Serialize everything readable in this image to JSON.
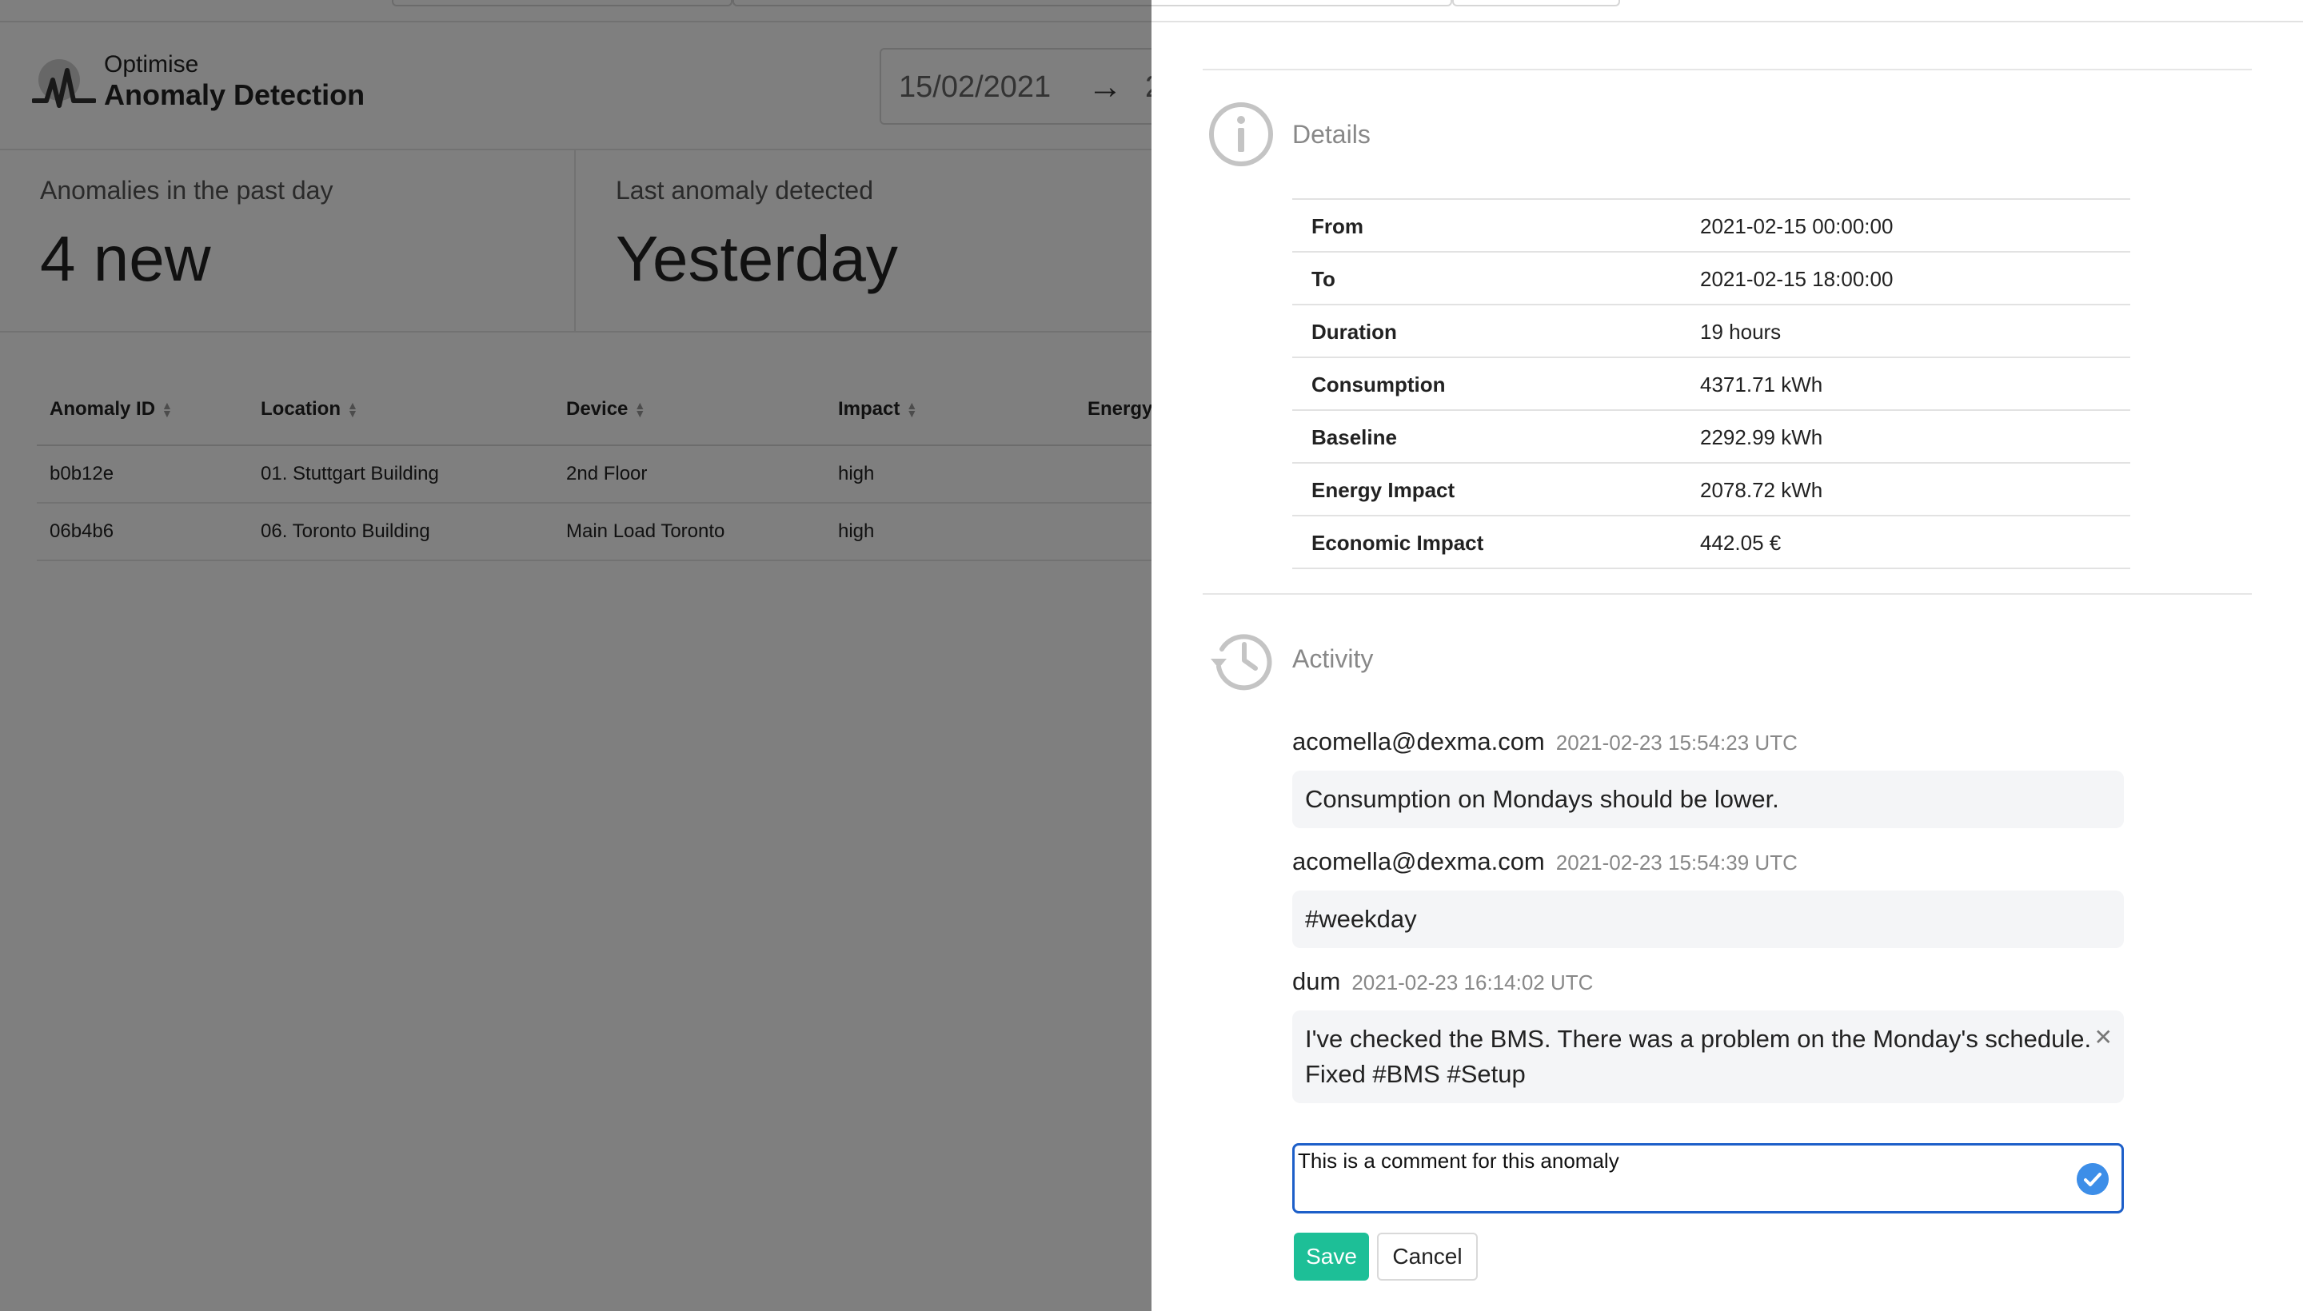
{
  "app": {
    "brand_sub": "Optimise",
    "brand_title": "Anomaly Detection",
    "date_from": "15/02/2021",
    "date_arrow": "→",
    "date_to_partial": "2"
  },
  "cards": [
    {
      "label": "Anomalies in the past day",
      "value": "4 new"
    },
    {
      "label": "Last anomaly detected",
      "value": "Yesterday"
    }
  ],
  "table": {
    "headers": [
      "Anomaly ID",
      "Location",
      "Device",
      "Impact",
      "Energy"
    ],
    "rows": [
      {
        "id": "b0b12e",
        "location": "01. Stuttgart Building",
        "device": "2nd Floor",
        "impact": "high"
      },
      {
        "id": "06b4b6",
        "location": "06. Toronto Building",
        "device": "Main Load Toronto",
        "impact": "high"
      }
    ]
  },
  "drawer": {
    "details_title": "Details",
    "details": [
      {
        "key": "From",
        "value": "2021-02-15 00:00:00"
      },
      {
        "key": "To",
        "value": "2021-02-15 18:00:00"
      },
      {
        "key": "Duration",
        "value": "19 hours"
      },
      {
        "key": "Consumption",
        "value": "4371.71 kWh"
      },
      {
        "key": "Baseline",
        "value": "2292.99 kWh"
      },
      {
        "key": "Energy Impact",
        "value": "2078.72 kWh"
      },
      {
        "key": "Economic Impact",
        "value": "442.05 €"
      }
    ],
    "activity_title": "Activity",
    "comments": [
      {
        "author": "acomella@dexma.com",
        "timestamp": "2021-02-23 15:54:23 UTC",
        "lines": [
          "Consumption on Mondays should be lower."
        ]
      },
      {
        "author": "acomella@dexma.com",
        "timestamp": "2021-02-23 15:54:39 UTC",
        "lines": [
          "#weekday"
        ]
      },
      {
        "author": "dum",
        "timestamp": "2021-02-23 16:14:02 UTC",
        "lines": [
          "I've checked the BMS. There was a problem on the Monday's schedule.",
          "Fixed #BMS #Setup"
        ]
      }
    ],
    "comment_input_value": "This is a comment for this anomaly",
    "save_label": "Save",
    "cancel_label": "Cancel"
  },
  "colors": {
    "overlay": "#808080",
    "impact_high": "#c0392b",
    "save_button": "#1dbf97",
    "input_border": "#1d5fc9",
    "check_icon": "#3d8ee8"
  }
}
